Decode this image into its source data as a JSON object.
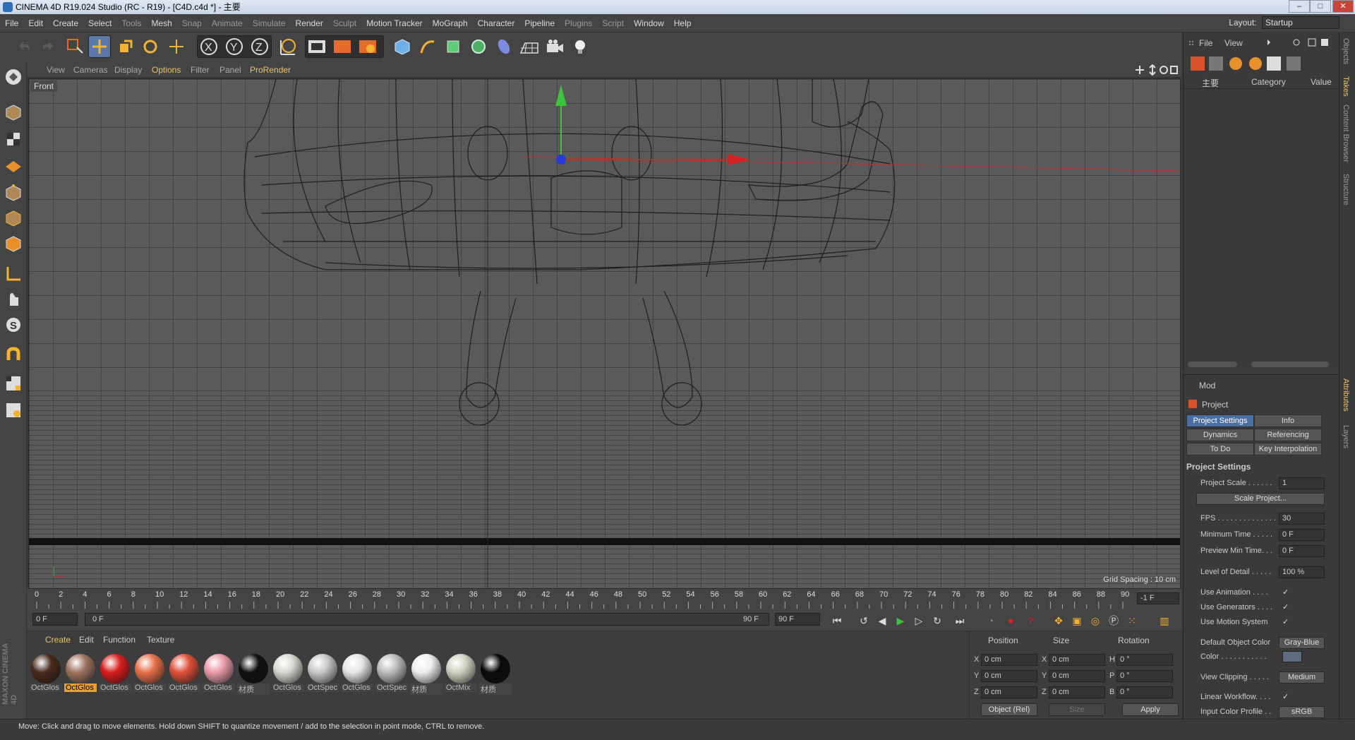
{
  "title": "CINEMA 4D R19.024 Studio (RC - R19) - [C4D.c4d *] - 主要",
  "menu": [
    "File",
    "Edit",
    "Create",
    "Select",
    "Tools",
    "Mesh",
    "Snap",
    "Animate",
    "Simulate",
    "Render",
    "Sculpt",
    "Motion Tracker",
    "MoGraph",
    "Character",
    "Pipeline",
    "Plugins",
    "Script",
    "Window",
    "Help"
  ],
  "layout": {
    "label": "Layout:",
    "value": "Startup"
  },
  "viewport": {
    "menu": [
      "View",
      "Cameras",
      "Display",
      "Options",
      "Filter",
      "Panel",
      "ProRender"
    ],
    "active_menu": "Options",
    "label": "Front",
    "grid_spacing": "Grid Spacing : 10 cm"
  },
  "timeline": {
    "ticks": [
      "0",
      "2",
      "4",
      "6",
      "8",
      "10",
      "12",
      "14",
      "16",
      "18",
      "20",
      "22",
      "24",
      "26",
      "28",
      "30",
      "32",
      "34",
      "36",
      "38",
      "40",
      "42",
      "44",
      "46",
      "48",
      "50",
      "52",
      "54",
      "56",
      "58",
      "60",
      "62",
      "64",
      "66",
      "68",
      "70",
      "72",
      "74",
      "76",
      "78",
      "80",
      "82",
      "84",
      "86",
      "88",
      "90"
    ],
    "current": "-1 F",
    "start": "0 F",
    "slider_start": "0 F",
    "slider_end": "90 F",
    "end": "90 F"
  },
  "materials": {
    "menu": [
      "Create",
      "Edit",
      "Function",
      "Texture"
    ],
    "items": [
      {
        "label": "OctGlos",
        "color": "#4a2a1e",
        "selected": false
      },
      {
        "label": "OctGlos",
        "color": "#a07560",
        "selected": true
      },
      {
        "label": "OctGlos",
        "color": "#d81e1e",
        "selected": false
      },
      {
        "label": "OctGlos",
        "color": "#e8704a",
        "selected": false
      },
      {
        "label": "OctGlos",
        "color": "#e0503a",
        "selected": false
      },
      {
        "label": "OctGlos",
        "color": "#e89aa8",
        "selected": false
      },
      {
        "label": "材质",
        "color": "#111111",
        "selected": false
      },
      {
        "label": "OctGlos",
        "color": "#d8d8d0",
        "selected": false
      },
      {
        "label": "OctSpec",
        "color": "#c8c8c8",
        "selected": false
      },
      {
        "label": "OctGlos",
        "color": "#e6e6e6",
        "selected": false
      },
      {
        "label": "OctSpec",
        "color": "#bdbdbd",
        "selected": false
      },
      {
        "label": "材质",
        "color": "#eeeeee",
        "selected": false
      },
      {
        "label": "OctMix",
        "color": "#d0d0c0",
        "selected": false
      },
      {
        "label": "材质",
        "color": "#0a0a0a",
        "selected": false
      }
    ]
  },
  "coords": {
    "headers": [
      "Position",
      "Size",
      "Rotation"
    ],
    "rows": [
      {
        "axis": "X",
        "pos": "0 cm",
        "saxis": "X",
        "size": "0 cm",
        "raxis": "H",
        "rot": "0 °"
      },
      {
        "axis": "Y",
        "pos": "0 cm",
        "saxis": "Y",
        "size": "0 cm",
        "raxis": "P",
        "rot": "0 °"
      },
      {
        "axis": "Z",
        "pos": "0 cm",
        "saxis": "Z",
        "size": "0 cm",
        "raxis": "B",
        "rot": "0 °"
      }
    ],
    "mode": "Object (Rel)",
    "size_mode": "Size",
    "apply": "Apply"
  },
  "status": "Move: Click and drag to move elements. Hold down SHIFT to quantize movement / add to the selection in point mode, CTRL to remove.",
  "objects": {
    "menu": [
      "File",
      "View"
    ],
    "columns": [
      "主要",
      "Category",
      "Value"
    ]
  },
  "attributes": {
    "menu": "Mod",
    "title": "Project",
    "tabs": [
      "Project Settings",
      "Info",
      "Dynamics",
      "Referencing",
      "To Do",
      "Key Interpolation"
    ],
    "section": "Project Settings",
    "project_scale_label": "Project Scale . . . . . .",
    "project_scale": "1",
    "scale_project": "Scale Project...",
    "fps_label": "FPS . . . . . . . . . . . . . .",
    "fps": "30",
    "min_time_label": "Minimum Time . . . . .",
    "min_time": "0 F",
    "preview_min_label": "Preview Min Time. . .",
    "preview_min": "0 F",
    "lod_label": "Level of Detail . . . . .",
    "lod": "100 %",
    "use_animation": "Use Animation . . . .",
    "use_generators": "Use Generators . . . .",
    "use_motion": "Use Motion System",
    "default_color_label": "Default Object Color",
    "default_color": "Gray-Blue",
    "color_label": "Color . . . . . . . . . . .",
    "view_clipping_label": "View Clipping . . . . .",
    "view_clipping": "Medium",
    "linear_workflow": "Linear Workflow. . . .",
    "input_profile_label": "Input Color Profile . .",
    "input_profile": "sRGB",
    "check": "✓"
  },
  "side_tabs": [
    "Objects",
    "Takes",
    "Content Browser",
    "Structure",
    "Attributes",
    "Layers"
  ],
  "logo": "MAXON CINEMA 4D"
}
